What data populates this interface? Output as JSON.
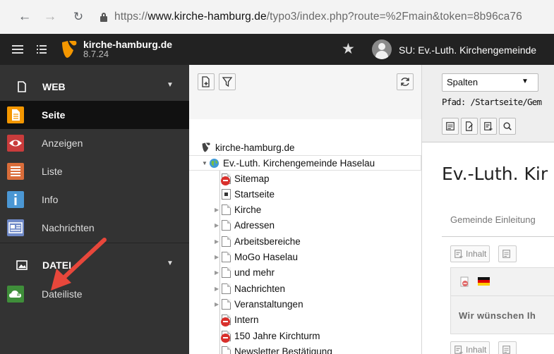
{
  "browser": {
    "url_scheme": "https://",
    "url_host": "www.kirche-hamburg.de",
    "url_path": "/typo3/index.php?route=%2Fmain&token=8b96ca76"
  },
  "topbar": {
    "site_name": "kirche-hamburg.de",
    "version": "8.7.24",
    "user_label": "SU: Ev.-Luth. Kirchengemeinde"
  },
  "module_menu": {
    "web_group": "WEB",
    "items": [
      {
        "label": "Seite",
        "color": "#f49700"
      },
      {
        "label": "Anzeigen",
        "color": "#c93c3c"
      },
      {
        "label": "Liste",
        "color": "#da6d3a"
      },
      {
        "label": "Info",
        "color": "#4b97d4"
      },
      {
        "label": "Nachrichten",
        "color": "#6f89c7"
      }
    ],
    "file_group": "DATEI",
    "file_items": [
      {
        "label": "Dateiliste",
        "color": "#3f8e3a"
      }
    ]
  },
  "tree": {
    "root": "kirche-hamburg.de",
    "selected": "Ev.-Luth. Kirchengemeinde Haselau",
    "pages": [
      {
        "label": "Sitemap",
        "icon": "restricted-page-icon"
      },
      {
        "label": "Startseite",
        "icon": "shortcut-page-icon"
      },
      {
        "label": "Kirche",
        "icon": "page-icon"
      },
      {
        "label": "Adressen",
        "icon": "page-icon"
      },
      {
        "label": "Arbeitsbereiche",
        "icon": "page-icon"
      },
      {
        "label": "MoGo Haselau",
        "icon": "page-icon"
      },
      {
        "label": "und mehr",
        "icon": "page-icon"
      },
      {
        "label": "Nachrichten",
        "icon": "page-icon"
      },
      {
        "label": "Veranstaltungen",
        "icon": "page-icon"
      },
      {
        "label": "Intern",
        "icon": "restricted-page-icon"
      },
      {
        "label": "150 Jahre Kirchturm",
        "icon": "restricted-page-icon"
      },
      {
        "label": "Newsletter Bestätigung",
        "icon": "page-icon"
      }
    ]
  },
  "content": {
    "view_select": "Spalten",
    "path": "Pfad: /Startseite/Gem",
    "title": "Ev.-Luth. Kir",
    "tab": "Gemeinde Einleitung",
    "btn_inhalt_1": "Inhalt",
    "btn_inhalt_2": "Inhalt",
    "ce_text": "Wir wünschen Ih"
  }
}
